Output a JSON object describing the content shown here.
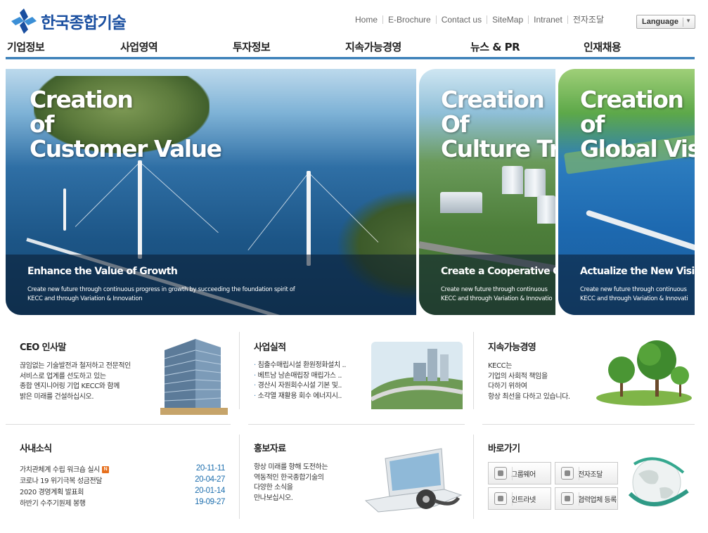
{
  "header": {
    "logo_text": "한국종합기술",
    "top_links": [
      "Home",
      "E-Brochure",
      "Contact us",
      "SiteMap",
      "Intranet",
      "전자조달"
    ],
    "language_label": "Language"
  },
  "main_nav": [
    "기업정보",
    "사업영역",
    "투자정보",
    "지속가능경영",
    "뉴스 & PR",
    "인재채용"
  ],
  "banners": [
    {
      "title_lines": [
        "Creation",
        "of",
        "Customer Value"
      ],
      "subtitle": "Enhance the Value of Growth",
      "desc_lines": [
        "Create new future through continuous progress in growth by succeeding the foundation spirit of",
        "KECC and through Variation & Innovation"
      ]
    },
    {
      "title_lines": [
        "Creation",
        "Of",
        "Culture Tr"
      ],
      "subtitle": "Create a Cooperative Co",
      "desc_lines": [
        "Create new future through continuous",
        "KECC and through Variation & Innovatio"
      ]
    },
    {
      "title_lines": [
        "Creation",
        "of",
        "Global Visi"
      ],
      "subtitle": "Actualize the New Vision",
      "desc_lines": [
        "Create new future through continuous",
        "KECC and through Variation & Innovati"
      ]
    }
  ],
  "ceo": {
    "title": "CEO 인사말",
    "lines": [
      "끊임없는 기술발전과 철저하고 전문적인",
      "서비스로 업계를 선도하고 있는",
      "종합 엔지니어링 기업 KECC와 함께",
      "밝은 미래를 건설하십시오."
    ]
  },
  "projects": {
    "title": "사업실적",
    "items": [
      "침출수매립시설 환원정화설치 ..",
      "베트남 남손매립장 매립가스 ..",
      "경산시 자원회수시설 기본 및..",
      "소각열 재활용 회수 에너지시.."
    ]
  },
  "sustainability": {
    "title": "지속가능경영",
    "lines": [
      "KECC는",
      "기업의 사회적 책임을",
      "다하기 위하여",
      "항상 최선을 다하고 있습니다."
    ]
  },
  "company_news": {
    "title": "사내소식",
    "new_badge": "N",
    "items": [
      {
        "title": "가치관체계 수립 워크숍 실시",
        "date": "20-11-11",
        "is_new": true
      },
      {
        "title": "코로나 19 위기극복 성금전달",
        "date": "20-04-27",
        "is_new": false
      },
      {
        "title": "2020 경영계획 발표회",
        "date": "20-01-14",
        "is_new": false
      },
      {
        "title": "하반기 수주기원제 봉행",
        "date": "19-09-27",
        "is_new": false
      }
    ]
  },
  "pr": {
    "title": "홍보자료",
    "lines": [
      "항상 미래를 향해 도전하는",
      "역동적인 한국종합기술의",
      "다양한 소식을",
      "만나보십시오."
    ]
  },
  "shortcuts": {
    "title": "바로가기",
    "buttons": [
      "그룹웨어",
      "전자조달",
      "인트라넷",
      "협력업체 등록"
    ]
  },
  "colors": {
    "brand_blue": "#1a4fa0",
    "nav_line": "#3a7fb8",
    "date_blue": "#1e6fae",
    "new_badge": "#e6701e"
  }
}
